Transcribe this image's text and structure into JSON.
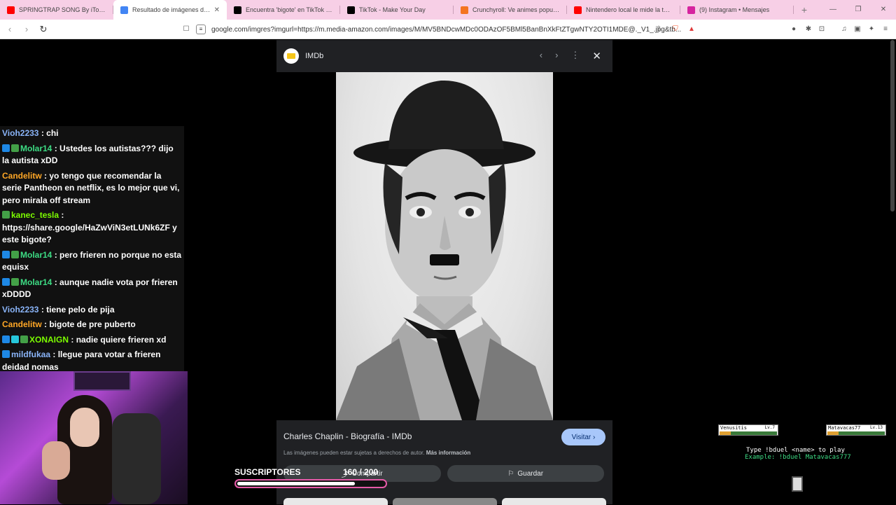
{
  "browser": {
    "tabs": [
      {
        "title": "SPRINGTRAP SONG By iTownGamePlay",
        "icon": "youtube-icon",
        "color": "#ff0000"
      },
      {
        "title": "Resultado de imágenes de Google",
        "icon": "google-icon",
        "color": "#4285f4"
      },
      {
        "title": "Encuentra 'bigote' en TikTok | Buscar",
        "icon": "tiktok-icon",
        "color": "#000000"
      },
      {
        "title": "TikTok - Make Your Day",
        "icon": "tiktok-icon",
        "color": "#000000"
      },
      {
        "title": "Crunchyroll: Ve animes populares, juega",
        "icon": "crunchyroll-icon",
        "color": "#f47521"
      },
      {
        "title": "Nintendero local le mide la tula a Tod",
        "icon": "youtube-icon",
        "color": "#ff0000"
      },
      {
        "title": "(9) Instagram • Mensajes",
        "icon": "instagram-icon",
        "color": "#d6249f"
      }
    ],
    "url": "google.com/imgres?imgurl=https://m.media-amazon.com/images/M/MV5BNDcwMDc0ODAzOF5BMl5BanBnXkFtZTgwNTY2OTI1MDE@._V1_.jpg&tb...",
    "new_tab": "+",
    "win_controls": [
      "—",
      "❐",
      "✕"
    ],
    "brave_badge": "5"
  },
  "panel": {
    "source": "IMDb",
    "caption": "Charles Chaplin - Biografía - IMDb",
    "visit_label": "Visitar",
    "copyright": "Las imágenes pueden estar sujetas a derechos de autor.",
    "more_info": "Más información",
    "share_label": "Compartir",
    "save_label": "Guardar"
  },
  "chat": [
    {
      "user": "Vioh2233",
      "user_color": "#8ab4f8",
      "badges": [],
      "text": "chi"
    },
    {
      "user": "Molar14",
      "user_color": "#3ddc84",
      "badges": [
        "#1e88e5",
        "#43a047"
      ],
      "text": "Ustedes los autistas??? dijo la autista xDD"
    },
    {
      "user": "Candelitw",
      "user_color": "#ffa726",
      "badges": [],
      "text": "yo tengo que recomendar la serie Pantheon en netflix, es lo mejor que vi, pero mirala off stream"
    },
    {
      "user": "kanec_tesla",
      "user_color": "#7cfc00",
      "badges": [
        "#43a047"
      ],
      "text": "https://share.google/HaZwViN3etLUNk6ZF y este bigote?"
    },
    {
      "user": "Molar14",
      "user_color": "#3ddc84",
      "badges": [
        "#1e88e5",
        "#43a047"
      ],
      "text": "pero frieren no porque no esta equisx"
    },
    {
      "user": "Molar14",
      "user_color": "#3ddc84",
      "badges": [
        "#1e88e5",
        "#43a047"
      ],
      "text": "aunque nadie vota por frieren xDDDD"
    },
    {
      "user": "Vioh2233",
      "user_color": "#8ab4f8",
      "badges": [],
      "text": "tiene pelo de pija"
    },
    {
      "user": "Candelitw",
      "user_color": "#ffa726",
      "badges": [],
      "text": "bigote de pre puberto"
    },
    {
      "user": "XONAIGN",
      "user_color": "#7cfc00",
      "badges": [
        "#1e88e5",
        "#26c6da",
        "#43a047"
      ],
      "text": "nadie quiere frieren xd"
    },
    {
      "user": "mildfukaa",
      "user_color": "#8ab4f8",
      "badges": [
        "#1e88e5"
      ],
      "text": "llegue para votar a frieren deidad nomas"
    }
  ],
  "subs": {
    "label": "SUSCRIPTORES",
    "count": "160 / 200",
    "progress": 0.8
  },
  "duel": {
    "player1": {
      "name": "Venusitis",
      "level": "Lv.7",
      "hp": 0.2
    },
    "player2": {
      "name": "Matavacas77",
      "level": "Lv.13",
      "hp": 0.2
    },
    "instruction": "Type !bduel <name> to play",
    "example": "Example: !bduel Matavacas777"
  }
}
